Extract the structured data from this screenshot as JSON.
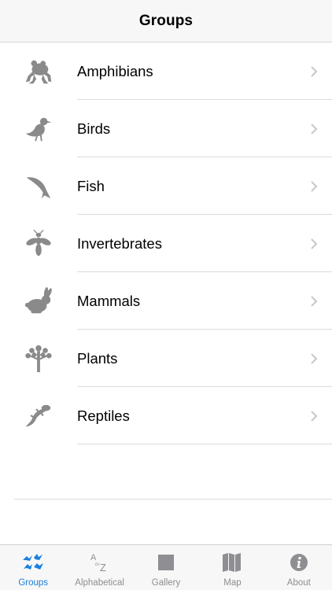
{
  "nav": {
    "title": "Groups"
  },
  "groups": [
    {
      "label": "Amphibians",
      "icon": "frog-icon"
    },
    {
      "label": "Birds",
      "icon": "bird-icon"
    },
    {
      "label": "Fish",
      "icon": "fish-icon"
    },
    {
      "label": "Invertebrates",
      "icon": "insect-icon"
    },
    {
      "label": "Mammals",
      "icon": "rabbit-icon"
    },
    {
      "label": "Plants",
      "icon": "tree-icon"
    },
    {
      "label": "Reptiles",
      "icon": "lizard-icon"
    }
  ],
  "tabs": [
    {
      "label": "Groups",
      "icon": "birds-group-icon",
      "active": true
    },
    {
      "label": "Alphabetical",
      "icon": "a-to-z-icon",
      "active": false
    },
    {
      "label": "Gallery",
      "icon": "gallery-square-icon",
      "active": false
    },
    {
      "label": "Map",
      "icon": "map-icon",
      "active": false
    },
    {
      "label": "About",
      "icon": "info-icon",
      "active": false
    }
  ],
  "colors": {
    "icon_gray": "#8a8a8a",
    "accent": "#1a7fe0",
    "chevron": "#c7c7cc",
    "tab_inactive": "#8e8e93"
  }
}
